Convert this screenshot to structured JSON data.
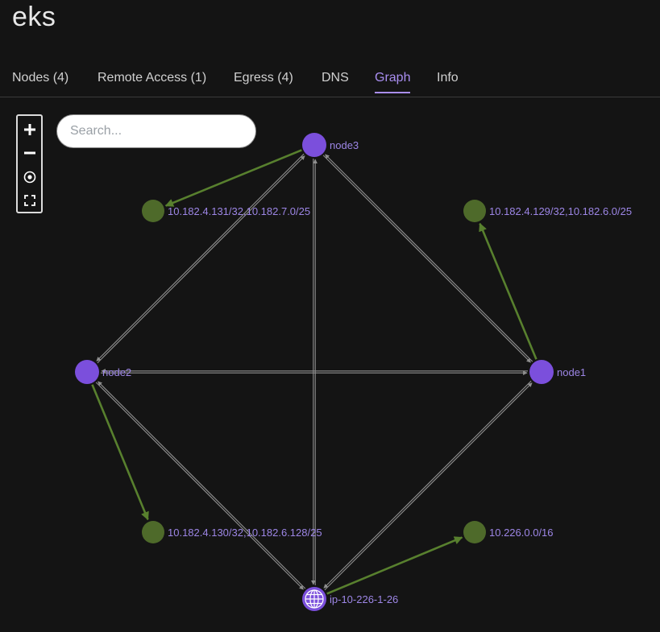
{
  "page": {
    "title": "eks"
  },
  "tabs": [
    {
      "label": "Nodes (4)",
      "active": false
    },
    {
      "label": "Remote Access (1)",
      "active": false
    },
    {
      "label": "Egress (4)",
      "active": false
    },
    {
      "label": "DNS",
      "active": false
    },
    {
      "label": "Graph",
      "active": true
    },
    {
      "label": "Info",
      "active": false
    }
  ],
  "zoom_controls": [
    {
      "name": "zoom-in",
      "icon": "plus-icon"
    },
    {
      "name": "zoom-out",
      "icon": "minus-icon"
    },
    {
      "name": "center",
      "icon": "target-icon"
    },
    {
      "name": "fit-screen",
      "icon": "fullscreen-icon"
    }
  ],
  "search": {
    "placeholder": "Search..."
  },
  "colors": {
    "node": "#7b4fdc",
    "route": "#4e6a2a",
    "edge_mesh": "#8f8f8f",
    "edge_route": "#58802e",
    "label": "#9d86e6",
    "tab_active": "#a98ef0"
  },
  "graph": {
    "nodes": [
      {
        "id": "node3",
        "label": "node3",
        "kind": "node"
      },
      {
        "id": "node2",
        "label": "node2",
        "kind": "node"
      },
      {
        "id": "node1",
        "label": "node1",
        "kind": "node"
      },
      {
        "id": "ip",
        "label": "ip-10-226-1-26",
        "kind": "gateway"
      },
      {
        "id": "r3",
        "label": "10.182.4.131/32,10.182.7.0/25",
        "kind": "route"
      },
      {
        "id": "r1",
        "label": "10.182.4.129/32,10.182.6.0/25",
        "kind": "route"
      },
      {
        "id": "r2",
        "label": "10.182.4.130/32,10.182.6.128/25",
        "kind": "route"
      },
      {
        "id": "rip",
        "label": "10.226.0.0/16",
        "kind": "route"
      }
    ],
    "mesh_edges": [
      [
        "node2",
        "node1"
      ],
      [
        "node1",
        "node2"
      ],
      [
        "node2",
        "node3"
      ],
      [
        "node3",
        "node2"
      ],
      [
        "node1",
        "node3"
      ],
      [
        "node3",
        "node1"
      ],
      [
        "node3",
        "ip"
      ],
      [
        "ip",
        "node3"
      ],
      [
        "node2",
        "ip"
      ],
      [
        "ip",
        "node2"
      ],
      [
        "node1",
        "ip"
      ],
      [
        "ip",
        "node1"
      ]
    ],
    "route_edges": [
      [
        "node3",
        "r3"
      ],
      [
        "node1",
        "r1"
      ],
      [
        "node2",
        "r2"
      ],
      [
        "ip",
        "rip"
      ]
    ]
  }
}
